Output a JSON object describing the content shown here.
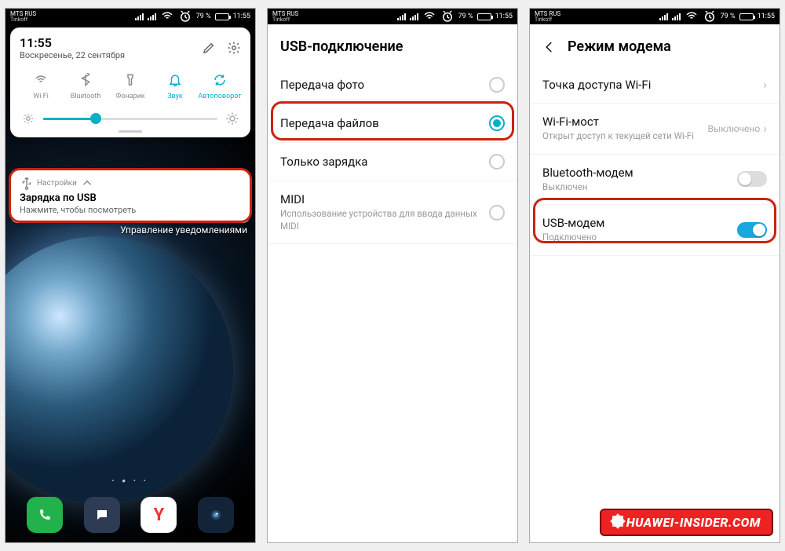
{
  "statusbar": {
    "carrier_line1": "MTS RUS",
    "carrier_line2": "Tinkoff",
    "battery_pct": "79 %",
    "time": "11:55",
    "alarm": true
  },
  "phone1": {
    "qs": {
      "time": "11:55",
      "date": "Воскресенье, 22 сентября",
      "items": [
        {
          "label": "Wi Fi",
          "icon": "wifi-icon",
          "active": false
        },
        {
          "label": "Bluetooth",
          "icon": "bluetooth-icon",
          "active": false
        },
        {
          "label": "Фонарик",
          "icon": "flashlight-icon",
          "active": false
        },
        {
          "label": "Звук",
          "icon": "bell-icon",
          "active": true
        },
        {
          "label": "Автоповорот",
          "icon": "rotate-icon",
          "active": true
        }
      ],
      "brightness_pct": 30
    },
    "notification": {
      "app": "Настройки",
      "title": "Зарядка по USB",
      "subtitle": "Нажмите, чтобы посмотреть"
    },
    "manage_label": "Управление уведомлениями",
    "dock": [
      {
        "name": "phone-app",
        "color": "#22b24c",
        "glyph": "phone"
      },
      {
        "name": "messages-app",
        "color": "#2d3b55",
        "glyph": "message"
      },
      {
        "name": "yandex-app",
        "color": "#ffffff",
        "glyph": "Y"
      },
      {
        "name": "camera-app",
        "color": "#132338",
        "glyph": "camera"
      }
    ]
  },
  "phone2": {
    "title": "USB-подключение",
    "options": [
      {
        "label": "Передача фото",
        "selected": false,
        "hint": ""
      },
      {
        "label": "Передача файлов",
        "selected": true,
        "hint": ""
      },
      {
        "label": "Только зарядка",
        "selected": false,
        "hint": ""
      },
      {
        "label": "MIDI",
        "selected": false,
        "hint": "Использование устройства для ввода данных MIDI"
      }
    ]
  },
  "phone3": {
    "title": "Режим модема",
    "rows": [
      {
        "kind": "link",
        "label": "Точка доступа Wi-Fi",
        "sub": ""
      },
      {
        "kind": "link",
        "label": "Wi-Fi-мост",
        "sub": "Открыт доступ к текущей сети Wi-Fi",
        "value": "Выключено"
      },
      {
        "kind": "toggle",
        "label": "Bluetooth-модем",
        "sub": "Выключен",
        "on": false
      },
      {
        "kind": "toggle",
        "label": "USB-модем",
        "sub": "Подключено",
        "on": true,
        "highlight": true
      }
    ]
  },
  "watermark": "HUAWEI-INSIDER.COM"
}
